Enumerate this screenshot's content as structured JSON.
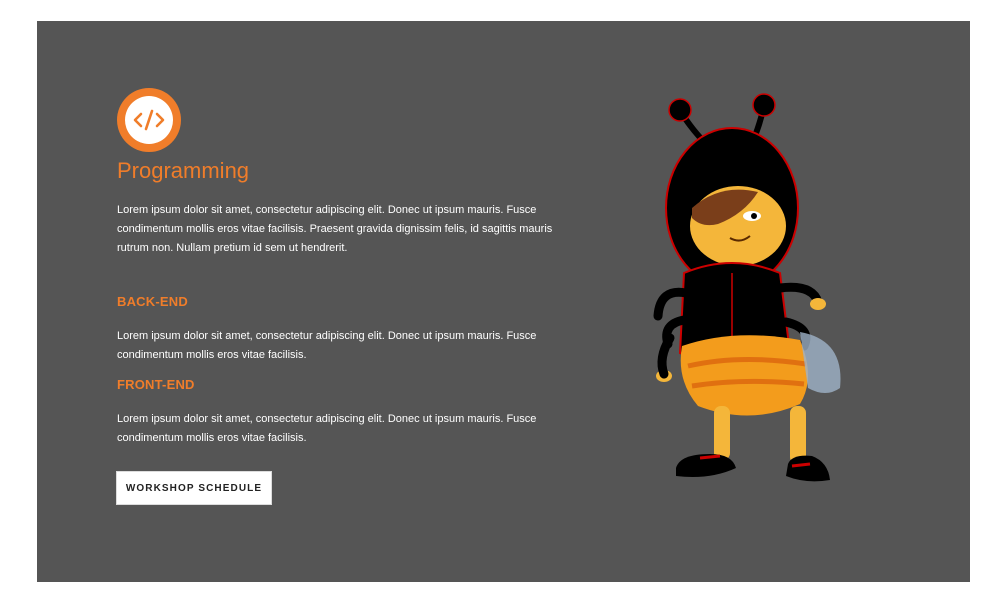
{
  "hero": {
    "title": "Programming",
    "intro": "Lorem ipsum dolor sit amet, consectetur adipiscing elit. Donec ut ipsum mauris. Fusce condimentum mollis eros vitae facilisis. Praesent gravida dignissim felis, id sagittis mauris rutrum non. Nullam pretium id sem ut hendrerit.",
    "icon": "code-icon"
  },
  "sections": [
    {
      "heading": "BACK-END",
      "text": "Lorem ipsum dolor sit amet, consectetur adipiscing elit. Donec ut ipsum mauris. Fusce condimentum mollis eros vitae facilisis."
    },
    {
      "heading": "FRONT-END",
      "text": "Lorem ipsum dolor sit amet, consectetur adipiscing elit. Donec ut ipsum mauris. Fusce condimentum mollis eros vitae facilisis."
    }
  ],
  "cta": {
    "label": "WORKSHOP SCHEDULE"
  },
  "illustration": {
    "icon": "bee-mascot-illustration"
  },
  "colors": {
    "accent": "#f07d2a",
    "panel": "#555555",
    "text": "#ffffff"
  }
}
